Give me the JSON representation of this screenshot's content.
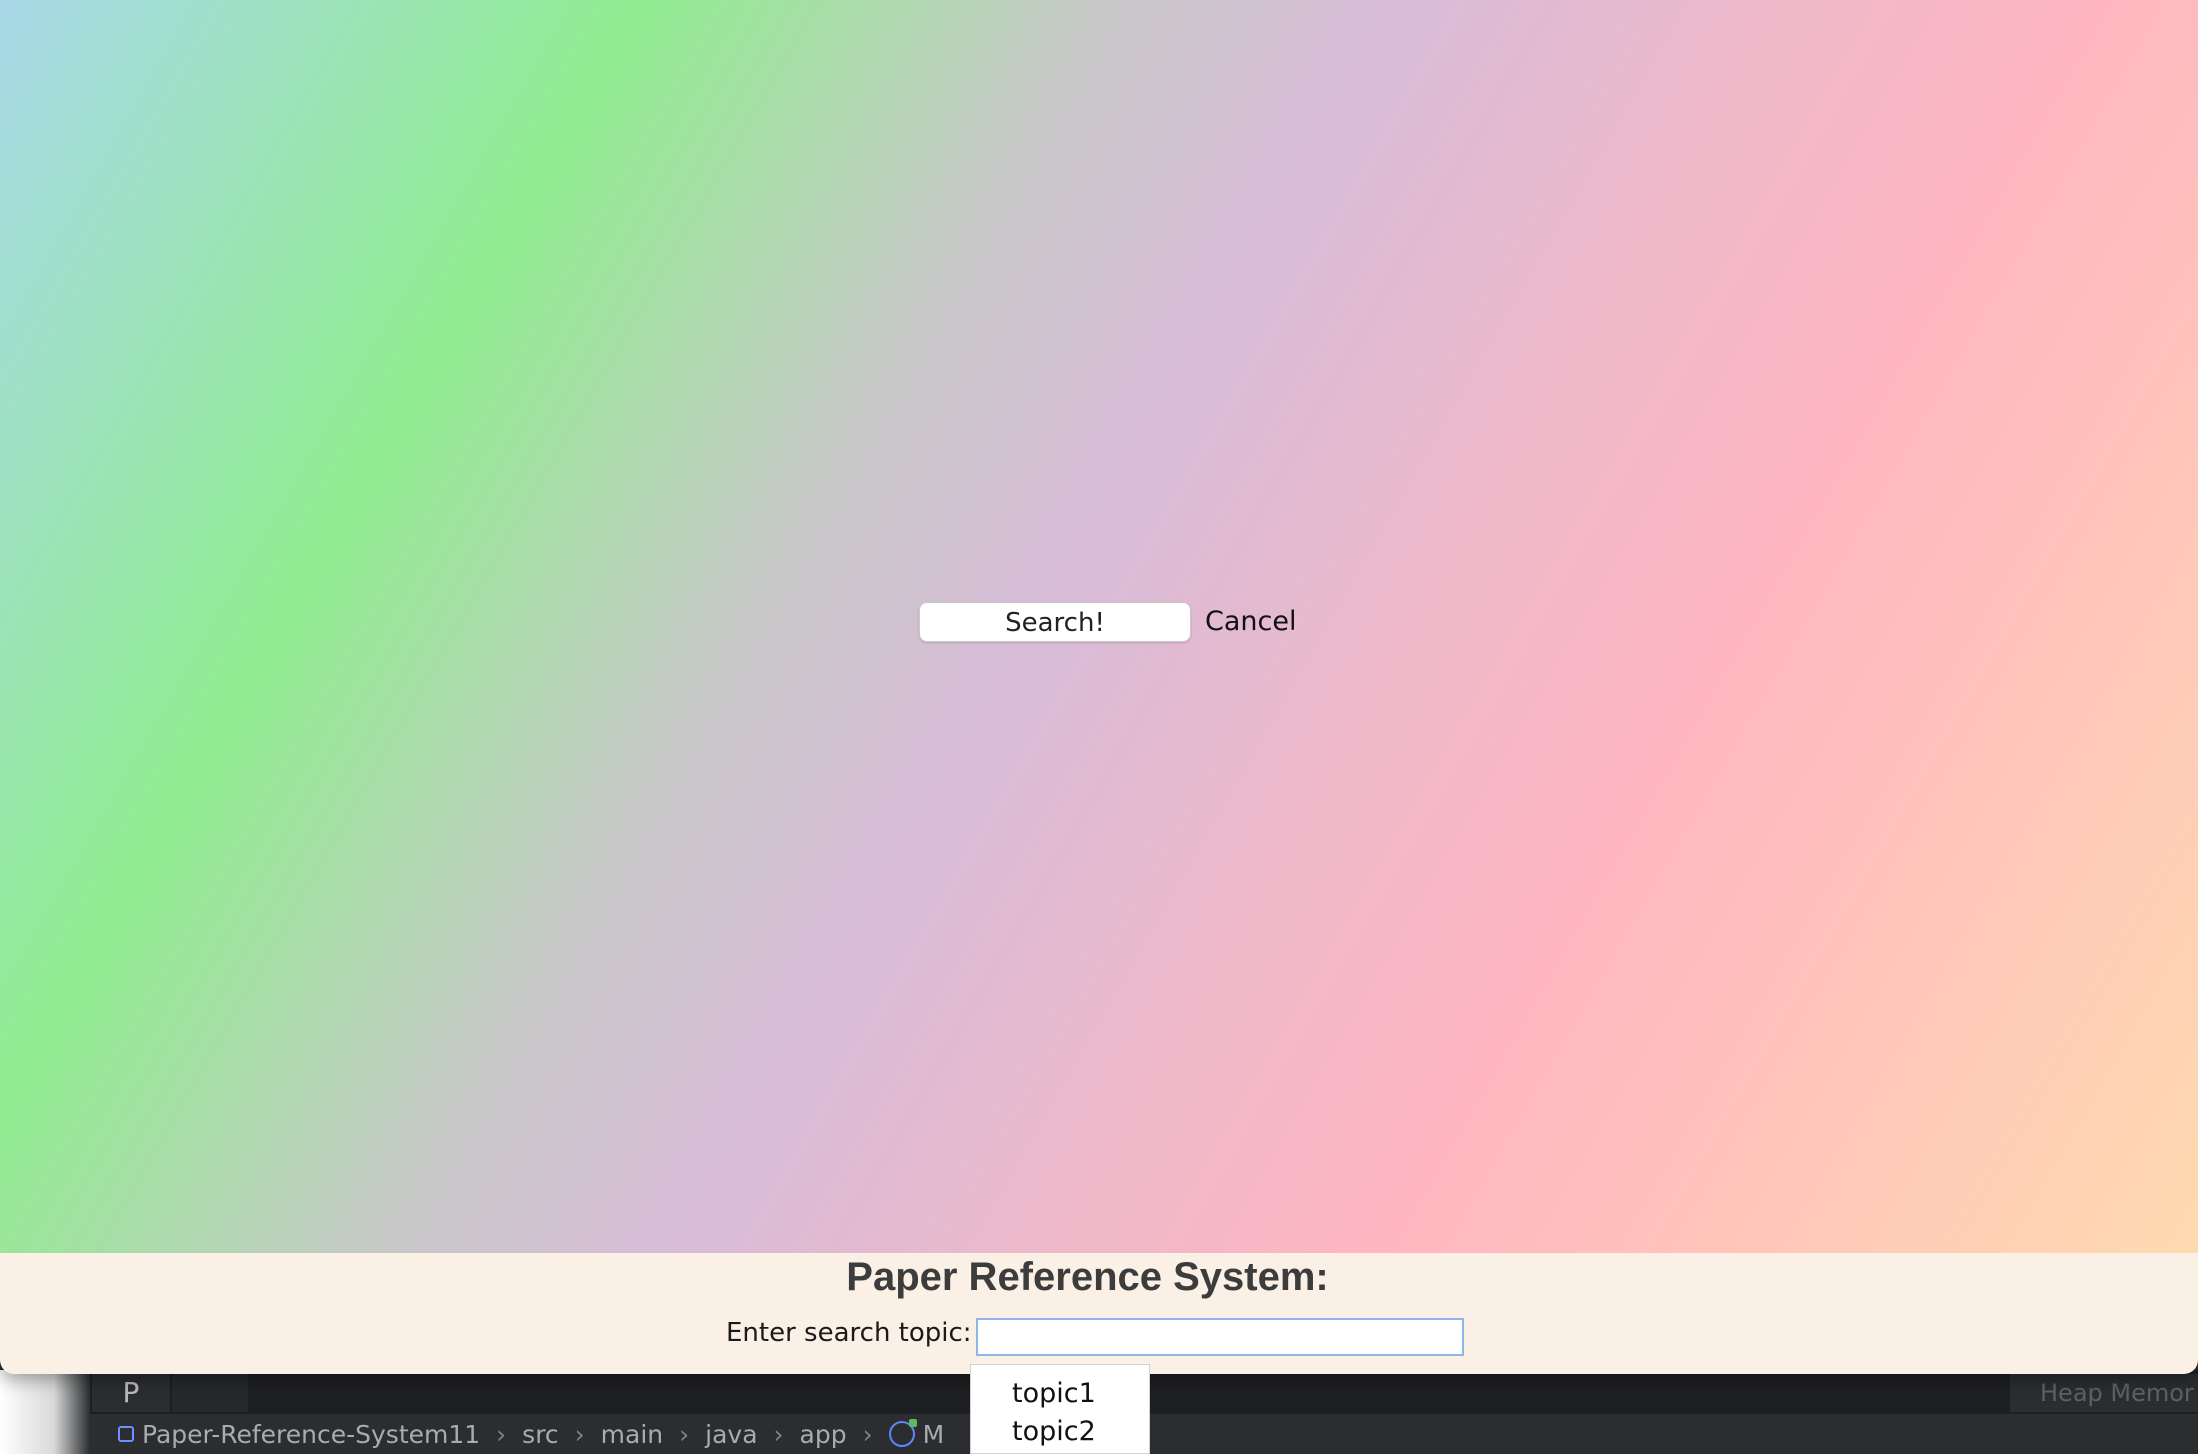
{
  "app": {
    "title": "Paper Reference System:",
    "search_label": "Enter search topic:",
    "search_value": "",
    "search_button_label": "Search!",
    "cancel_button_label": "Cancel",
    "suggestions": [
      "topic1",
      "topic2"
    ],
    "colors": {
      "bottom_panel": "#faf0e6",
      "input_border": "#8fb6e8"
    }
  },
  "ide": {
    "tool_tab_letter": "P",
    "heap_label": "Heap Memor",
    "breadcrumbs": [
      "Paper-Reference-System11",
      "src",
      "main",
      "java",
      "app",
      "M"
    ],
    "icons": {
      "project": "project-icon",
      "class": "class-icon"
    }
  }
}
